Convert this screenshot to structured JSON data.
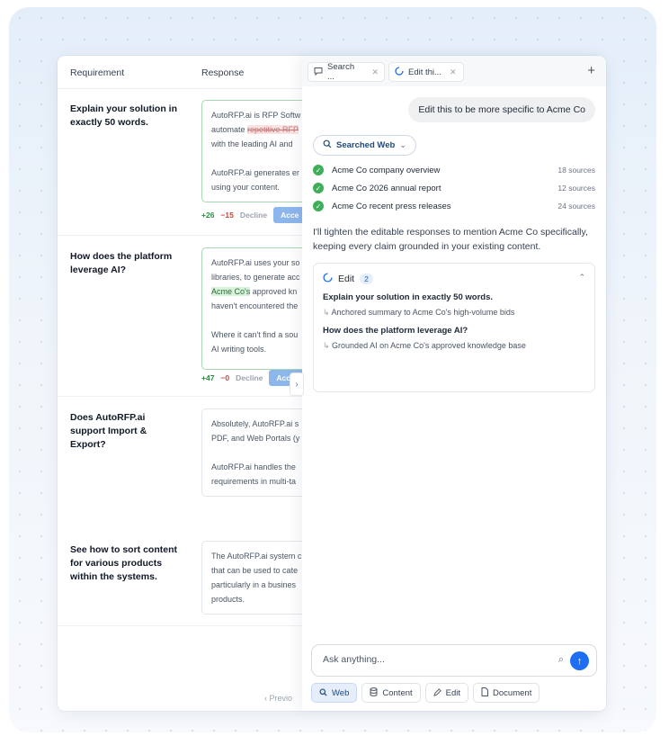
{
  "table": {
    "headers": {
      "requirement": "Requirement",
      "response": "Response"
    },
    "rows": [
      {
        "requirement": "Explain your solution in exactly 50 words.",
        "response_lines": [
          "AutoRFP.ai is RFP Softw",
          "automate ",
          "repetitive RFP",
          "with the leading AI and",
          "AutoRFP.ai generates er",
          "using your content."
        ],
        "added": "+26",
        "removed": "−15",
        "decline": "Decline",
        "accept": "Acce"
      },
      {
        "requirement": "How does the platform leverage AI?",
        "response_lines": [
          "AutoRFP.ai uses your so",
          "libraries, to generate acc",
          "Acme Co's",
          " approved kn",
          "haven't encountered the",
          "Where it can't find a sou",
          "AI writing tools."
        ],
        "added": "+47",
        "removed": "−0",
        "decline": "Decline",
        "accept": "Acc"
      },
      {
        "requirement": "Does AutoRFP.ai support Import & Export?",
        "response_lines": [
          "Absolutely, AutoRFP.ai s",
          "PDF, and Web Portals (y",
          "AutoRFP.ai handles the",
          "requirements in multi-ta"
        ]
      },
      {
        "requirement": "See how to sort content for various products within the systems.",
        "response_lines": [
          "The AutoRFP.ai system c",
          "that can be used to cate",
          "particularly in a busines",
          "products."
        ]
      }
    ],
    "pager": "‹  Previo"
  },
  "panel": {
    "tabs": [
      {
        "label": "Search ...",
        "icon": "chat-icon"
      },
      {
        "label": "Edit thi...",
        "icon": "spinner-icon"
      }
    ],
    "new_tab": "+",
    "user_message": "Edit this to be more specific to Acme Co",
    "searched_label": "Searched Web",
    "sources": [
      {
        "title": "Acme Co company overview",
        "count": "18 sources"
      },
      {
        "title": "Acme Co 2026 annual report",
        "count": "12 sources"
      },
      {
        "title": "Acme Co recent press releases",
        "count": "24 sources"
      }
    ],
    "assistant_message": "I'll tighten the editable responses to mention Acme Co specifically, keeping every claim grounded in your existing content.",
    "edit_card": {
      "title": "Edit",
      "count": "2",
      "items": [
        {
          "title": "Explain your solution in exactly 50 words.",
          "detail": "Anchored summary to Acme Co's high-volume bids"
        },
        {
          "title": "How does the platform leverage AI?",
          "detail": "Grounded AI on Acme Co's approved knowledge base"
        }
      ]
    },
    "input_placeholder": "Ask anything...",
    "modes": [
      {
        "label": "Web",
        "icon": "search-icon",
        "active": true
      },
      {
        "label": "Content",
        "icon": "database-icon",
        "active": false
      },
      {
        "label": "Edit",
        "icon": "pencil-icon",
        "active": false
      },
      {
        "label": "Document",
        "icon": "document-icon",
        "active": false
      }
    ]
  },
  "colors": {
    "accent": "#1d6ef0",
    "success": "#3fae5a",
    "accept": "#8db6ec"
  }
}
